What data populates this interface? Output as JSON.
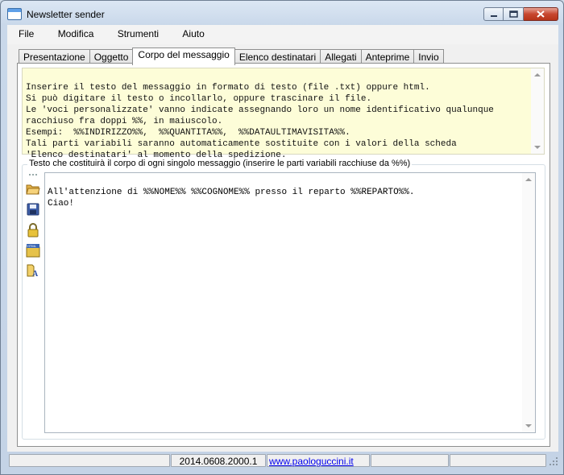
{
  "window": {
    "title": "Newsletter sender"
  },
  "menu": [
    "File",
    "Modifica",
    "Strumenti",
    "Aiuto"
  ],
  "tabs": [
    "Presentazione",
    "Oggetto",
    "Corpo del messaggio",
    "Elenco destinatari",
    "Allegati",
    "Anteprime",
    "Invio"
  ],
  "active_tab": "Corpo del messaggio",
  "instructions": {
    "lines": [
      "Inserire il testo del messaggio in formato di testo (file .txt) oppure html.",
      "Si può digitare il testo o incollarlo, oppure trascinare il file.",
      "Le 'voci personalizzate' vanno indicate assegnando loro un nome identificativo qualunque",
      "racchiuso fra doppi %%, in maiuscolo.",
      "Esempi:  %%INDIRIZZO%%,  %%QUANTITA%%,  %%DATAULTIMAVISITA%%.",
      "Tali parti variabili saranno automaticamente sostituite con i valori della scheda",
      "'Elenco destinatari' al momento della spedizione."
    ]
  },
  "body_group": {
    "legend": "Testo che costituirà il corpo di ogni singolo messaggio (inserire le parti variabili racchiuse da %%)",
    "tools": [
      "open-folder-icon",
      "save-icon",
      "lock-icon",
      "html-icon",
      "text-file-icon"
    ],
    "editor_lines": [
      "All'attenzione di %%NOME%% %%COGNOME%% presso il reparto %%REPARTO%%.",
      "Ciao!"
    ]
  },
  "status": {
    "version": "2014.0608.2000.1",
    "website": "www.paologuccini.it"
  },
  "colors": {
    "instructions_bg": "#fdfdd8",
    "link": "#0000ee",
    "close_button": "#c7462f"
  }
}
